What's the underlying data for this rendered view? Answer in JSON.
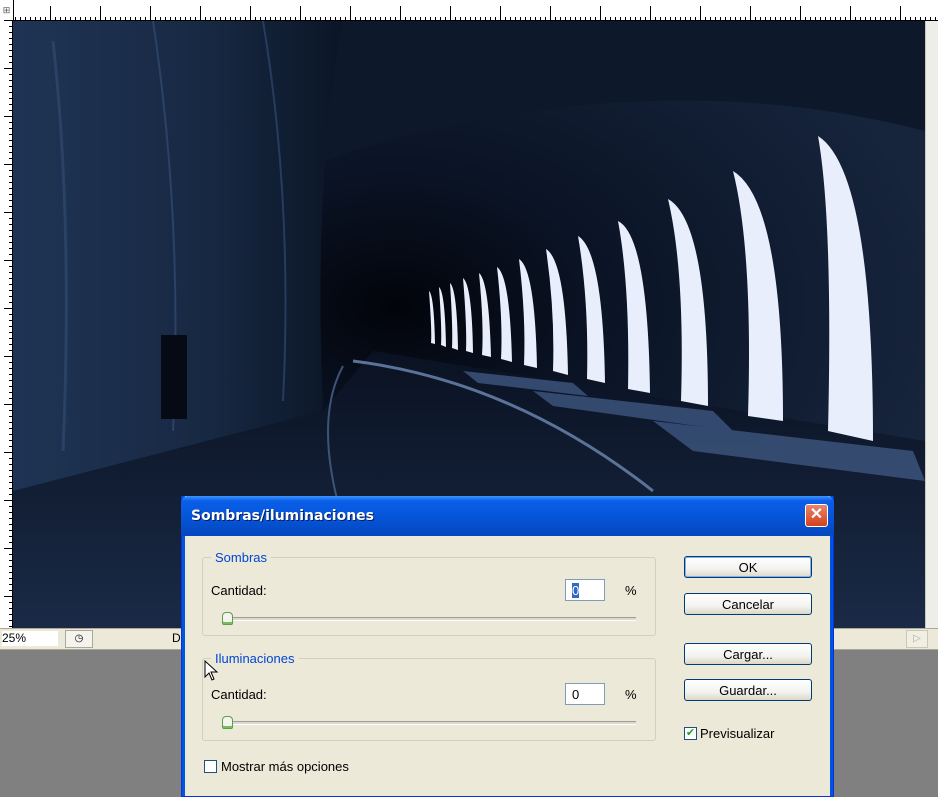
{
  "statusbar": {
    "zoom": "25%",
    "doc_label": "D"
  },
  "dialog": {
    "title": "Sombras/iluminaciones",
    "close_icon": "close-icon",
    "shadows": {
      "legend": "Sombras",
      "amount_label": "Cantidad:",
      "amount_value": "0",
      "unit": "%",
      "slider_fraction": 0
    },
    "highlights": {
      "legend": "Iluminaciones",
      "amount_label": "Cantidad:",
      "amount_value": "0",
      "unit": "%",
      "slider_fraction": 0
    },
    "buttons": {
      "ok": "OK",
      "cancel": "Cancelar",
      "load": "Cargar...",
      "save": "Guardar..."
    },
    "preview": {
      "label": "Previsualizar",
      "checked": true
    },
    "more_options": {
      "label": "Mostrar más opciones",
      "checked": false
    }
  },
  "colors": {
    "title_bar": "#0553d6",
    "dialog_bg": "#ece9d8",
    "legend_text": "#0046d5",
    "close_button": "#d2421b"
  }
}
